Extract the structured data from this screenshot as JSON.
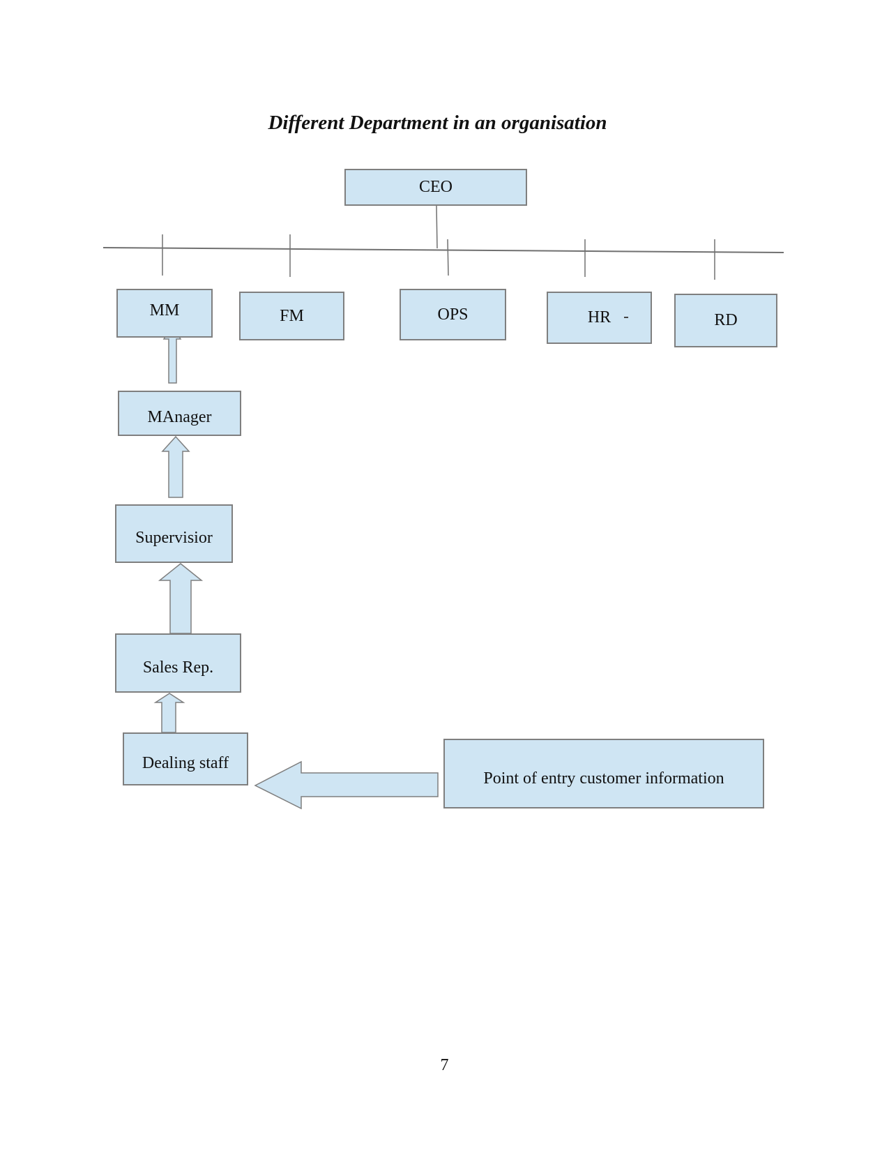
{
  "title": "Different Department in an organisation",
  "nodes": {
    "ceo": "CEO",
    "departments": [
      "MM",
      "FM",
      "OPS",
      "HR",
      "RD"
    ],
    "chain": [
      "MAnager",
      "Supervisior",
      "Sales Rep.",
      "Dealing staff"
    ],
    "entry": "Point of entry customer information"
  },
  "colors": {
    "box_fill": "#cfe5f3",
    "box_border": "#7f7f7f",
    "line": "#707070"
  },
  "page_number": "7"
}
